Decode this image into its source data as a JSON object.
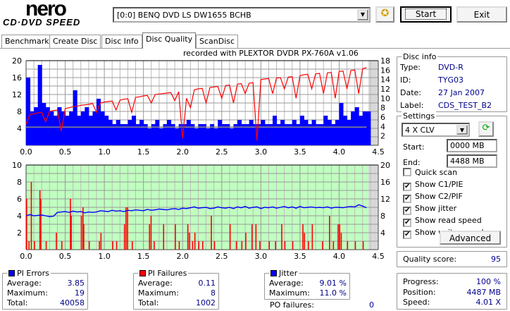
{
  "logo": {
    "top": "nero",
    "bottom": "CD·DVD SPEED"
  },
  "toolbar": {
    "drive": "[0:0]  BENQ DVD LS DW1655 BCHB",
    "start_label": "Start",
    "exit_label": "Exit"
  },
  "tabs": [
    {
      "label": "Benchmark"
    },
    {
      "label": "Create Disc"
    },
    {
      "label": "Disc Info"
    },
    {
      "label": "Disc Quality"
    },
    {
      "label": "ScanDisc"
    }
  ],
  "recorded_with": "recorded with PLEXTOR DVDR   PX-760A   v1.06",
  "disc_info": {
    "title": "Disc info",
    "type_label": "Type:",
    "type": "DVD-R",
    "id_label": "ID:",
    "id": "TYG03",
    "date_label": "Date:",
    "date": "27 Jan 2007",
    "label_label": "Label:",
    "label": "CDS_TEST_B2"
  },
  "settings": {
    "title": "Settings",
    "speed": "4 X CLV",
    "start_label": "Start:",
    "start": "0000 MB",
    "end_label": "End:",
    "end": "4488 MB",
    "checks": [
      {
        "label": "Quick scan",
        "checked": false
      },
      {
        "label": "Show C1/PIE",
        "checked": true
      },
      {
        "label": "Show C2/PIF",
        "checked": true
      },
      {
        "label": "Show jitter",
        "checked": true
      },
      {
        "label": "Show read speed",
        "checked": true
      },
      {
        "label": "Show write speed",
        "checked": true
      }
    ],
    "advanced_label": "Advanced"
  },
  "quality": {
    "label": "Quality score:",
    "value": "95"
  },
  "pi_errors": {
    "title": "PI Errors",
    "color": "#0000ff",
    "average_label": "Average:",
    "average": "3.85",
    "maximum_label": "Maximum:",
    "maximum": "19",
    "total_label": "Total:",
    "total": "40058"
  },
  "pi_failures": {
    "title": "PI Failures",
    "color": "#ff0000",
    "average_label": "Average:",
    "average": "0.11",
    "maximum_label": "Maximum:",
    "maximum": "8",
    "total_label": "Total:",
    "total": "1002"
  },
  "jitter": {
    "title": "Jitter",
    "color": "#0000ff",
    "average_label": "Average:",
    "average": "9.01 %",
    "maximum_label": "Maximum:",
    "maximum": "11.0 %",
    "po_label": "PO failures:",
    "po": "0"
  },
  "progress": {
    "progress_label": "Progress:",
    "progress": "100 %",
    "position_label": "Position:",
    "position": "4487 MB",
    "speed_label": "Speed:",
    "speed": "4.01 X"
  },
  "chart_data": [
    {
      "type": "bar",
      "title": "PI Errors / Read speed",
      "xlim": [
        0,
        4.5
      ],
      "ylim": [
        0,
        20
      ],
      "y2lim": [
        0,
        18
      ],
      "xticks": [
        "0.0",
        "0.5",
        "1.0",
        "1.5",
        "2.0",
        "2.5",
        "3.0",
        "3.5",
        "4.0",
        "4.5"
      ],
      "yticks": [
        "4",
        "8",
        "12",
        "16",
        "20"
      ],
      "y2ticks": [
        "2",
        "4",
        "6",
        "8",
        "10",
        "12",
        "14",
        "16",
        "18"
      ],
      "x_start": 0,
      "x_step": 0.05,
      "pi_errors": [
        16,
        8,
        9,
        19,
        10,
        9,
        8,
        7,
        9,
        8,
        7,
        8,
        13,
        7,
        8,
        9,
        7,
        8,
        11,
        8,
        7,
        6,
        5,
        6,
        5,
        5,
        6,
        7,
        5,
        6,
        5,
        4,
        5,
        6,
        4,
        5,
        6,
        5,
        4,
        5,
        5,
        6,
        5,
        4,
        5,
        5,
        4,
        5,
        4,
        6,
        5,
        5,
        4,
        5,
        6,
        5,
        5,
        6,
        5,
        5,
        6,
        5,
        5,
        7,
        5,
        6,
        5,
        5,
        6,
        5,
        7,
        6,
        5,
        6,
        5,
        5,
        7,
        6,
        5,
        6,
        10,
        7,
        6,
        8,
        9,
        7,
        8,
        8
      ],
      "read_speed": [
        4.5,
        6.5,
        6.7,
        6.9,
        7.0,
        5.0,
        7.2,
        7.4,
        7.5,
        3.0,
        7.8,
        8.0,
        8.2,
        8.3,
        8.5,
        8.6,
        8.7,
        8.9,
        7.0,
        9.0,
        9.2,
        9.3,
        9.4,
        7.5,
        9.6,
        9.8,
        9.9,
        7.0,
        10.2,
        10.3,
        10.5,
        10.6,
        9.0,
        10.8,
        10.9,
        11.0,
        11.1,
        11.2,
        9.5,
        11.4,
        1.5,
        10.0,
        8.0,
        11.8,
        12.0,
        12.1,
        9.0,
        12.3,
        12.4,
        12.5,
        10.0,
        12.7,
        12.8,
        9.0,
        13.0,
        13.1,
        11.0,
        13.2,
        13.3,
        1.0,
        14.0,
        14.1,
        14.2,
        11.0,
        14.3,
        14.4,
        12.0,
        14.5,
        14.6,
        10.0,
        14.8,
        15.0,
        15.1,
        12.0,
        15.2,
        15.3,
        11.0,
        15.4,
        15.5,
        10.0,
        15.7,
        15.8,
        12.0,
        15.9,
        16.0,
        11.0,
        16.3,
        16.5
      ],
      "pi8_average_line": 4.3
    },
    {
      "type": "bar",
      "title": "PI Failures / Jitter",
      "xlim": [
        0,
        4.5
      ],
      "ylim": [
        0,
        10
      ],
      "y2lim": [
        0,
        20
      ],
      "xticks": [
        "0.0",
        "0.5",
        "1.0",
        "1.5",
        "2.0",
        "2.5",
        "3.0",
        "3.5",
        "4.0",
        "4.5"
      ],
      "yticks": [
        "2",
        "4",
        "6",
        "8",
        "10"
      ],
      "y2ticks": [
        "4",
        "8",
        "12",
        "16",
        "20"
      ],
      "x_start": 0,
      "x_step": 0.05,
      "jitter": [
        8.0,
        8.3,
        8.0,
        8.1,
        8.2,
        8.0,
        7.8,
        7.9,
        8.8,
        8.9,
        9.0,
        8.8,
        9.1,
        8.9,
        9.0,
        8.7,
        8.9,
        8.8,
        8.9,
        9.2,
        9.1,
        9.0,
        9.3,
        9.1,
        9.2,
        9.0,
        9.3,
        9.2,
        9.4,
        9.3,
        9.2,
        9.5,
        9.3,
        9.4,
        9.6,
        9.5,
        9.4,
        9.6,
        9.7,
        9.5,
        9.8,
        9.7,
        9.9,
        10.1,
        9.8,
        9.9,
        10.0,
        9.7,
        9.8,
        10.1,
        9.9,
        9.8,
        10.0,
        9.7,
        10.1,
        9.9,
        10.2,
        9.8,
        10.0,
        10.1,
        9.7,
        10.0,
        9.9,
        10.1,
        9.8,
        10.0,
        10.2,
        9.9,
        10.1,
        9.8,
        10.2,
        9.9,
        10.0,
        10.1,
        9.9,
        10.0,
        9.9,
        10.1,
        9.8,
        10.0,
        10.0,
        9.9,
        10.1,
        10.2,
        10.1,
        10.6,
        10.3,
        9.9
      ],
      "pi_failures": [
        [
          0.0,
          6
        ],
        [
          0.06,
          8
        ],
        [
          0.17,
          7
        ],
        [
          0.18,
          6
        ],
        [
          0.38,
          2
        ],
        [
          0.56,
          6
        ],
        [
          0.57,
          4
        ],
        [
          0.7,
          4
        ],
        [
          0.72,
          5
        ],
        [
          0.73,
          3
        ],
        [
          0.95,
          2
        ],
        [
          1.25,
          3
        ],
        [
          1.27,
          5
        ],
        [
          1.29,
          5
        ],
        [
          1.57,
          3
        ],
        [
          1.59,
          4
        ],
        [
          1.75,
          3
        ],
        [
          1.9,
          3
        ],
        [
          2.06,
          3
        ],
        [
          2.08,
          2
        ],
        [
          2.15,
          2
        ],
        [
          2.36,
          4
        ],
        [
          2.6,
          3
        ],
        [
          2.8,
          2
        ],
        [
          2.88,
          3
        ],
        [
          2.93,
          3
        ],
        [
          3.26,
          3
        ],
        [
          3.53,
          3
        ],
        [
          3.55,
          2
        ],
        [
          3.65,
          3
        ],
        [
          3.87,
          4
        ],
        [
          3.98,
          3
        ],
        [
          4.0,
          3
        ],
        [
          4.02,
          2
        ],
        [
          0.03,
          1
        ],
        [
          0.1,
          1
        ],
        [
          0.25,
          1
        ],
        [
          0.45,
          1
        ],
        [
          0.8,
          1
        ],
        [
          0.93,
          1
        ],
        [
          1.1,
          1
        ],
        [
          1.15,
          1
        ],
        [
          1.35,
          1
        ],
        [
          1.63,
          1
        ],
        [
          1.95,
          1
        ],
        [
          2.12,
          1
        ],
        [
          2.2,
          1
        ],
        [
          2.25,
          1
        ],
        [
          2.4,
          1
        ],
        [
          2.68,
          1
        ],
        [
          2.75,
          1
        ],
        [
          2.98,
          1
        ],
        [
          3.1,
          1
        ],
        [
          3.18,
          1
        ],
        [
          3.3,
          1
        ],
        [
          3.4,
          1
        ],
        [
          3.6,
          1
        ],
        [
          3.78,
          1
        ],
        [
          3.92,
          1
        ],
        [
          4.1,
          1
        ],
        [
          4.2,
          1
        ],
        [
          4.3,
          1
        ]
      ]
    }
  ]
}
